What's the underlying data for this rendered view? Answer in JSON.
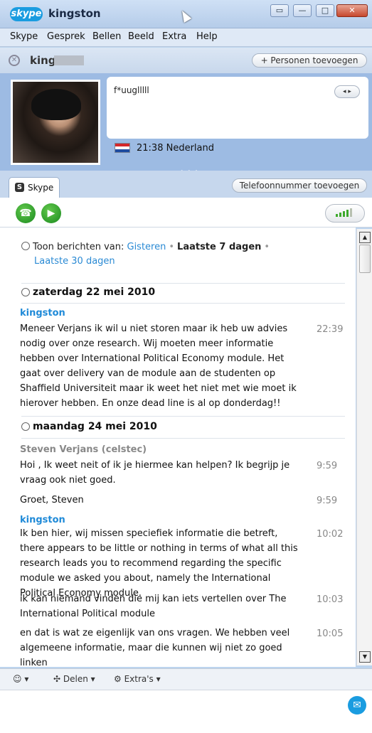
{
  "window": {
    "logo": "skype",
    "title": "kingston",
    "buttons": [
      "restore-icon",
      "minimize-icon",
      "maximize-icon",
      "close-icon"
    ]
  },
  "menu": [
    "Skype",
    "Gesprek",
    "Bellen",
    "Beeld",
    "Extra",
    "Help"
  ],
  "conversation": {
    "contact_name": "king",
    "add_people": "+ Personen toevoegen"
  },
  "profile": {
    "mood": "f*uuglllll",
    "local_time": "21:38 Nederland",
    "scroller": "◂ ▸"
  },
  "tabs": {
    "skype_tab": "Skype",
    "add_phone": "Telefoonnummer toevoegen"
  },
  "history": {
    "prefix": "Toon berichten van:",
    "yesterday": "Gisteren",
    "last7": "Laatste 7 dagen",
    "last30": "Laatste 30 dagen"
  },
  "days": {
    "day1": "zaterdag 22 mei 2010",
    "day2": "maandag 24 mei 2010"
  },
  "messages": {
    "m1_sender": "kingston",
    "m1_text": "Meneer Verjans ik wil u niet storen maar ik heb uw advies nodig over onze research. Wij moeten meer informatie hebben over International Political Economy module. Het gaat over delivery van de module aan de studenten op Shaffield Universiteit  maar ik weet het niet met wie moet ik hierover hebben. En onze dead line is al op donderdag!!",
    "m1_time": "22:39",
    "m2_sender": "Steven Verjans (celstec)",
    "m2_text": "Hoi      , Ik weet neit of ik je hiermee kan helpen? Ik begrijp je vraag ook niet goed.",
    "m2_time": "9:59",
    "m3_text": "Groet, Steven",
    "m3_time": "9:59",
    "m4_sender": "kingston",
    "m4_text": "Ik ben hier, wij missen speciefiek informatie die betreft,  there appears to be little or nothing in terms of what all this research leads you to recommend regarding the specific module we asked you about, namely the International Political Economy module.",
    "m4_time": "10:02",
    "m5_text": "ik kan niemand vinden die mij kan iets vertellen over The International Political module",
    "m5_time": "10:03",
    "m6_text": "en dat is wat ze eigenlijk van ons vragen. We hebben veel algemeene informatie, maar die kunnen wij niet zo goed linken",
    "m6_time": "10:05"
  },
  "toolbar": {
    "share": "Delen",
    "extras": "Extra's"
  },
  "colors": {
    "accent": "#1a9ce0",
    "sender_me": "#1f8ad8",
    "call_green": "#1a8a1f"
  }
}
